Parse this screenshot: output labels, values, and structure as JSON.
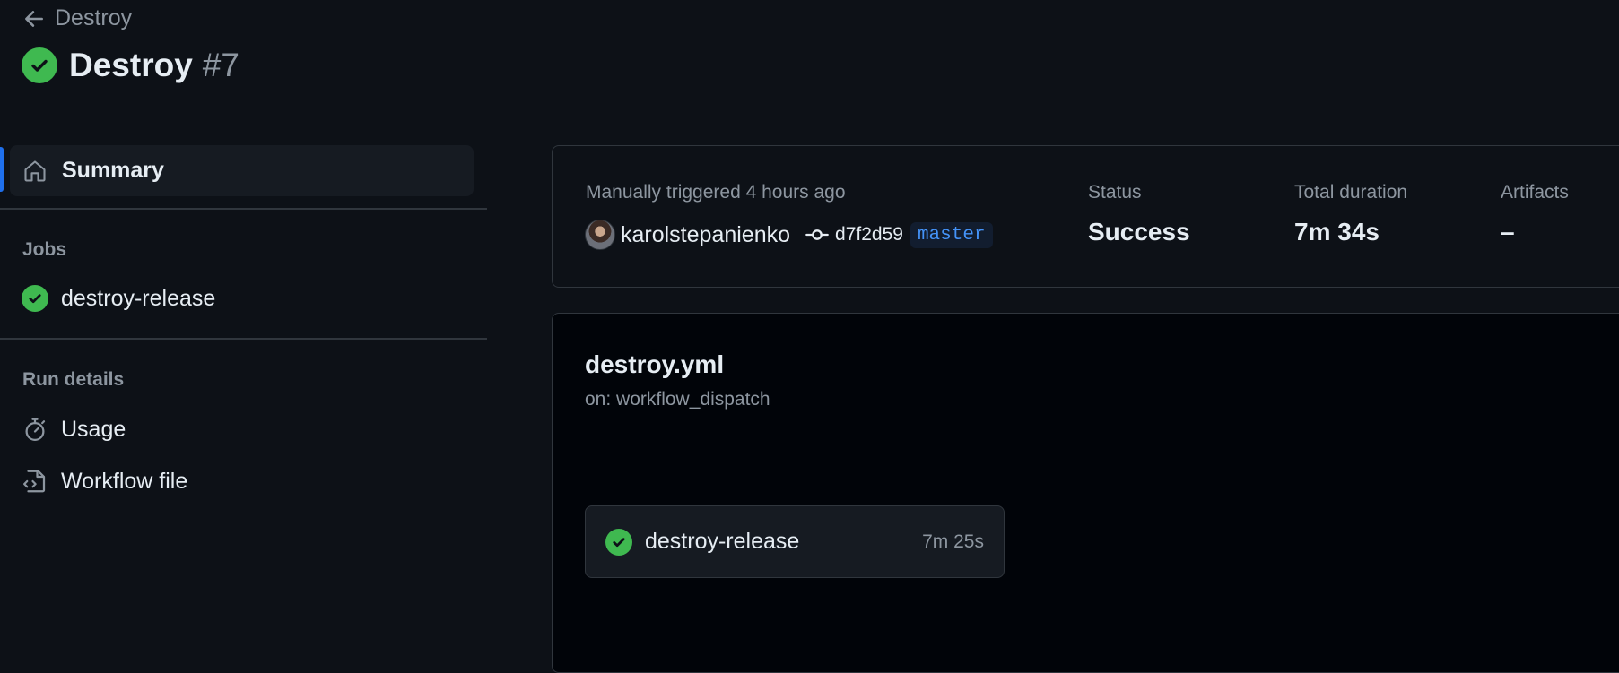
{
  "header": {
    "back_label": "Destroy",
    "title": "Destroy",
    "run_number": "#7",
    "status_color": "#3fb950"
  },
  "sidebar": {
    "summary_label": "Summary",
    "jobs_heading": "Jobs",
    "jobs": [
      {
        "label": "destroy-release",
        "status": "success"
      }
    ],
    "run_details_heading": "Run details",
    "run_details": [
      {
        "label": "Usage",
        "icon": "stopwatch-icon"
      },
      {
        "label": "Workflow file",
        "icon": "file-code-icon"
      }
    ]
  },
  "summary": {
    "trigger": "Manually triggered 4 hours ago",
    "actor": "karolstepanienko",
    "commit": "d7f2d59",
    "branch": "master",
    "status_label": "Status",
    "status_value": "Success",
    "duration_label": "Total duration",
    "duration_value": "7m 34s",
    "artifacts_label": "Artifacts",
    "artifacts_value": "–"
  },
  "workflow": {
    "file": "destroy.yml",
    "trigger": "on: workflow_dispatch",
    "job": {
      "name": "destroy-release",
      "duration": "7m 25s"
    }
  },
  "colors": {
    "background": "#0d1117",
    "accent": "#1f6feb",
    "success": "#3fb950",
    "branch": "#4493f8"
  }
}
